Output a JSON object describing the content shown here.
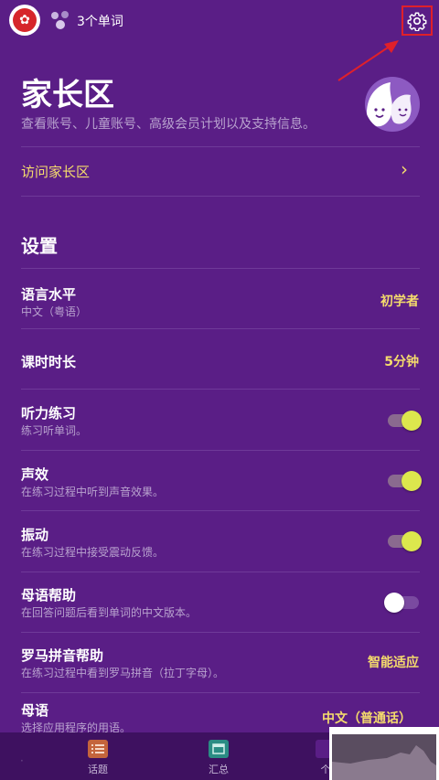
{
  "header": {
    "flag_icon": "hong-kong-flag-icon",
    "words_icon": "word-bubbles-icon",
    "words_count": "3个单词",
    "settings_icon": "gear-icon"
  },
  "parent": {
    "title": "家长区",
    "description": "查看账号、儿童账号、高级会员计划以及支持信息。",
    "visit_label": "访问家长区",
    "avatar_icon": "family-avatar-icon"
  },
  "settings": {
    "section_title": "设置",
    "language_level": {
      "title": "语言水平",
      "subtitle": "中文（粤语）",
      "value": "初学者"
    },
    "lesson_length": {
      "title": "课时时长",
      "value": "5分钟"
    },
    "listening": {
      "title": "听力练习",
      "subtitle": "练习听单词。",
      "enabled": true
    },
    "sound_effects": {
      "title": "声效",
      "subtitle": "在练习过程中听到声音效果。",
      "enabled": true
    },
    "vibration": {
      "title": "振动",
      "subtitle": "在练习过程中接受震动反馈。",
      "enabled": true
    },
    "native_help": {
      "title": "母语帮助",
      "subtitle": "在回答问题后看到单词的中文版本。",
      "enabled": false
    },
    "romanization": {
      "title": "罗马拼音帮助",
      "subtitle": "在练习过程中看到罗马拼音（拉丁字母）。",
      "value": "智能适应"
    },
    "native_language": {
      "title": "母语",
      "subtitle": "选择应用程序的用语。",
      "value": "中文（普通话）"
    }
  },
  "nav": {
    "topics": "话题",
    "summary": "汇总",
    "profile": "个"
  },
  "colors": {
    "background": "#5a1e86",
    "accent_yellow": "#f5dc6c",
    "toggle_on": "#dce74d",
    "annotation_red": "#e0202a"
  }
}
